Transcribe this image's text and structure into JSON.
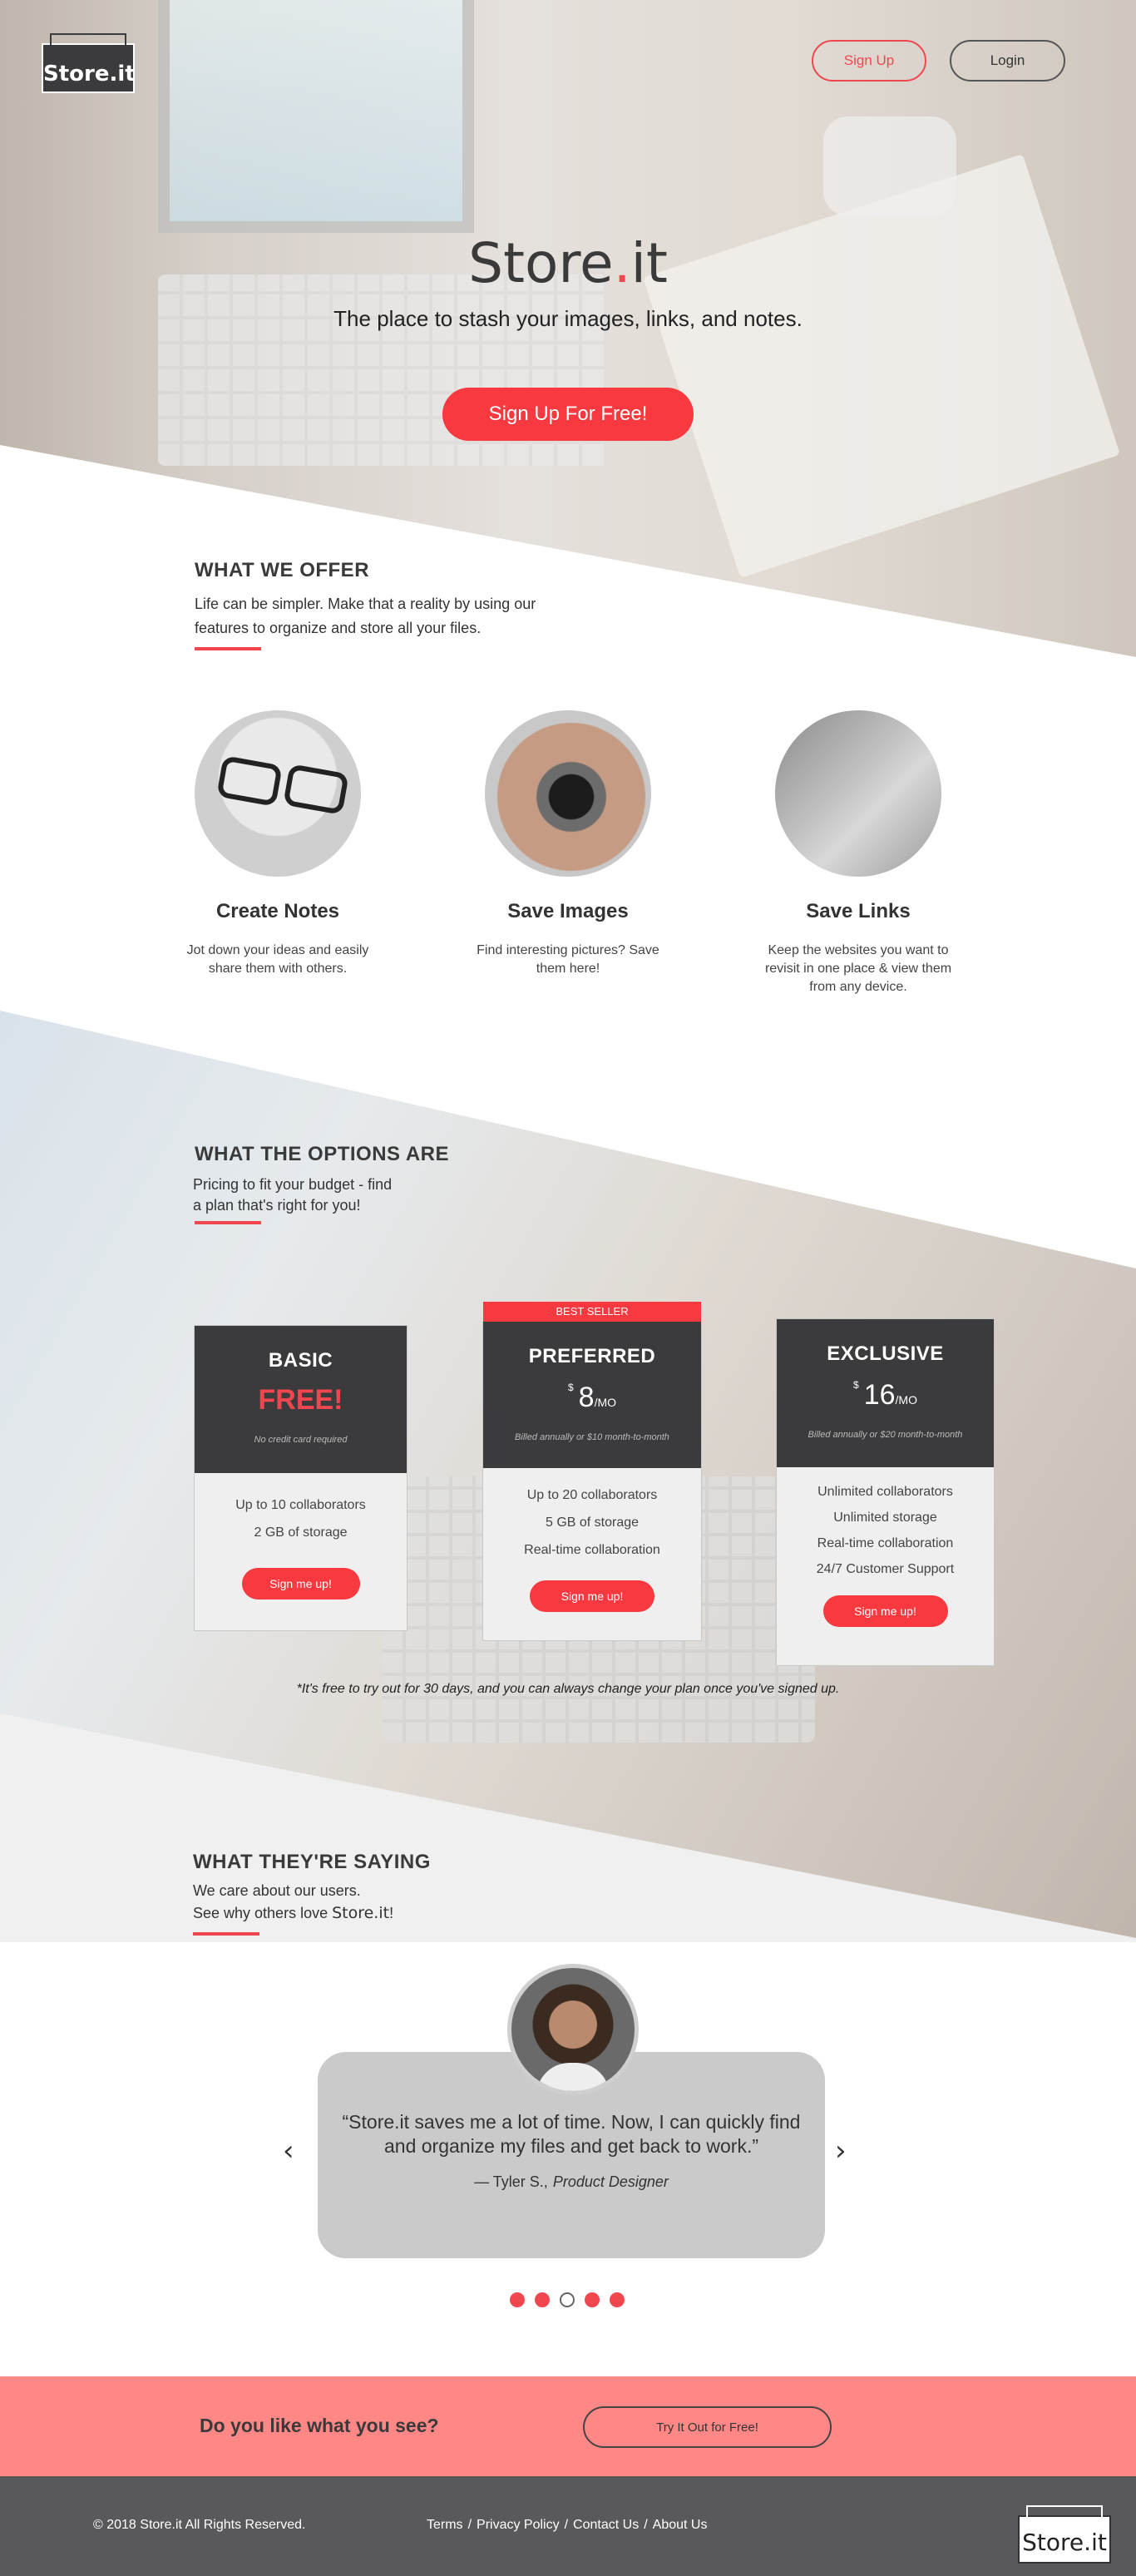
{
  "brand": {
    "logo_text": "Store.it",
    "title_prefix": "Store",
    "title_dot": ".",
    "title_suffix": "it"
  },
  "nav": {
    "signup_label": "Sign Up",
    "login_label": "Login"
  },
  "hero": {
    "tagline": "The place to stash your images, links, and notes.",
    "cta_label": "Sign Up For Free!"
  },
  "offer": {
    "title": "WHAT WE OFFER",
    "text": "Life can be simpler. Make that a reality by using our features to organize and store all your files.",
    "features": [
      {
        "title": "Create Notes",
        "text": "Jot down your ideas and easily share them with others."
      },
      {
        "title": "Save Images",
        "text": "Find interesting pictures? Save them here!"
      },
      {
        "title": "Save Links",
        "text": "Keep the websites you want to revisit in one place & view them from any device."
      }
    ]
  },
  "options": {
    "title": "WHAT THE OPTIONS ARE",
    "text": "Pricing to fit your budget - find a plan that's right for you!",
    "plans": [
      {
        "name": "BASIC",
        "price": "FREE!",
        "note": "No credit card required",
        "features": [
          "Up to 10 collaborators",
          "2 GB of storage"
        ],
        "cta": "Sign me up!"
      },
      {
        "name": "PREFERRED",
        "badge": "BEST SELLER",
        "currency": "$",
        "price": "8",
        "period": "/MO",
        "note": "Billed annually or $10 month-to-month",
        "features": [
          "Up to 20 collaborators",
          "5 GB of storage",
          "Real-time collaboration"
        ],
        "cta": "Sign me up!"
      },
      {
        "name": "EXCLUSIVE",
        "currency": "$",
        "price": "16",
        "period": "/MO",
        "note": "Billed annually or $20 month-to-month",
        "features": [
          "Unlimited collaborators",
          "Unlimited storage",
          "Real-time collaboration",
          "24/7 Customer Support"
        ],
        "cta": "Sign me up!"
      }
    ],
    "footnote": "*It's free to try out for 30 days, and you can always change your plan once you've signed up."
  },
  "testimonials": {
    "title": "WHAT THEY'RE SAYING",
    "text_line1": "We care about our users.",
    "text_line2_prefix": "See why others love ",
    "text_line2_brand": "Store.it",
    "text_line2_suffix": "!",
    "quote": "“Store.it saves me a lot of time. Now, I can quickly find and organize my files and get back to work.”",
    "author": "— Tyler S.,",
    "role": "Product Designer",
    "prev_icon": "‹",
    "next_icon": "›",
    "active_dot": 3,
    "dot_count": 5
  },
  "cta_band": {
    "question": "Do you like what you see?",
    "button": "Try It Out for Free!"
  },
  "footer": {
    "copyright": "© 2018 Store.it All Rights Reserved.",
    "links": [
      "Terms",
      "Privacy Policy",
      "Contact Us",
      "About Us"
    ],
    "separator": "/",
    "logo_text": "Store.it"
  },
  "colors": {
    "accent": "#f8393f",
    "dark": "#3b3b3d",
    "band": "#ff8786",
    "footer": "#59595b"
  }
}
